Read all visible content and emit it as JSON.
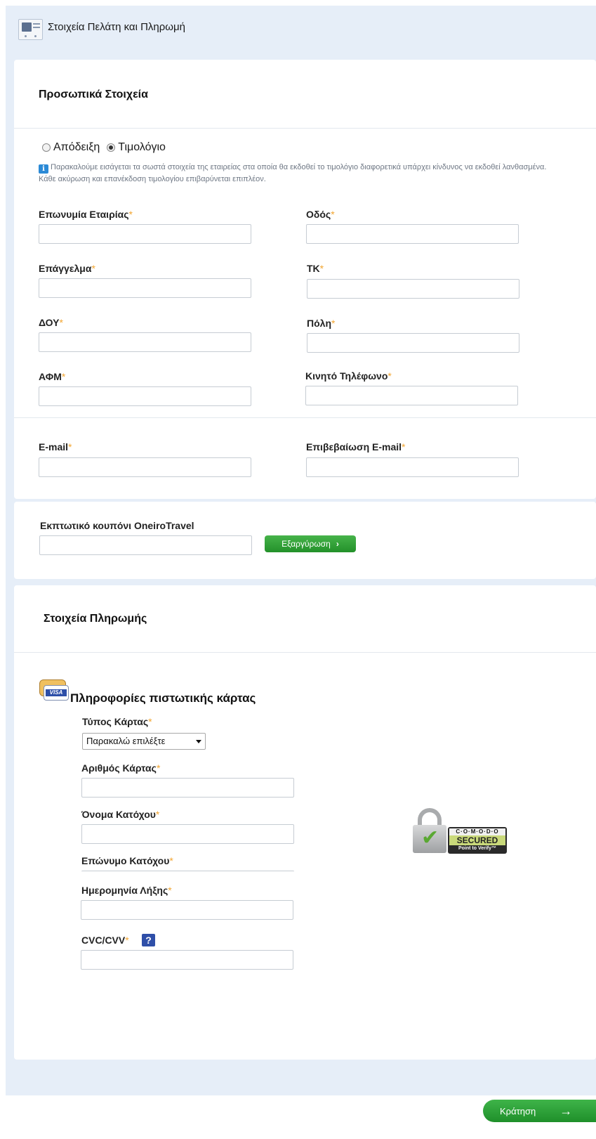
{
  "header": {
    "title": "Στοιχεία Πελάτη και Πληρωμή",
    "icon": "customer-card-icon"
  },
  "personal": {
    "title": "Προσωπικά Στοιχεία",
    "receipt_type": {
      "options": [
        "Απόδειξη",
        "Τιμολόγιο"
      ],
      "selected": "Τιμολόγιο"
    },
    "note": "Παρακαλούμε εισάγεται τα σωστά στοιχεία της εταιρείας στα οποία θα εκδοθεί το τιμολόγιο διαφορετικά υπάρχει κίνδυνος να εκδοθεί λανθασμένα. Κάθε ακύρωση και επανέκδοση τιμολογίου επιβαρύνεται επιπλέον.",
    "fields": {
      "company": "Επωνυμία Εταιρίας",
      "street": "Οδός",
      "profession": "Επάγγελμα",
      "zip": "ΤΚ",
      "tax_office": "ΔΟΥ",
      "city": "Πόλη",
      "vat": "ΑΦΜ",
      "mobile": "Κινητό Τηλέφωνο",
      "email": "E-mail",
      "email_confirm": "Επιβεβαίωση E-mail"
    },
    "required_mark": "*"
  },
  "coupon": {
    "label": "Εκπτωτικό κουπόνι OneiroTravel",
    "button": "Εξαργύρωση",
    "button_arrow": "›"
  },
  "payment": {
    "title": "Στοιχεία Πληρωμής",
    "card_section_title": "Πληροφορίες πιστωτικής κάρτας",
    "card_brand": "VISA",
    "card_type_label": "Τύπος Κάρτας",
    "card_type_value": "Παρακαλώ επιλέξτε",
    "card_number_label": "Αριθμός Κάρτας",
    "holder_name_label": "Όνομα Κατόχου",
    "holder_surname_label": "Επώνυμο Κατόχου",
    "expiry_label": "Ημερομηνία Λήξης",
    "cvc_label": "CVC/CVV",
    "help_glyph": "?",
    "secure_badge": {
      "top": "C·O·M·O·D·O",
      "middle": "SECURED",
      "bottom": "Point to Verify™"
    }
  },
  "footer": {
    "book_button": "Κράτηση",
    "book_arrow": "→"
  },
  "colors": {
    "page_bg": "#e6eef8",
    "panel_bg": "#ffffff",
    "accent_green": "#2fa03a",
    "required": "#f2a530"
  }
}
